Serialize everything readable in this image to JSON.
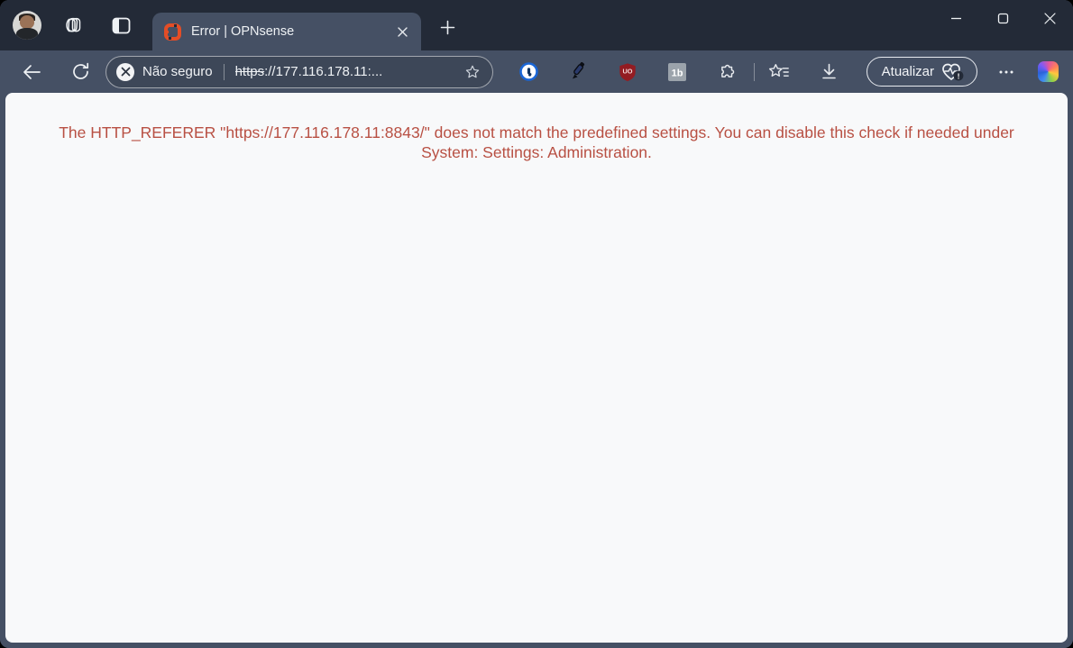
{
  "window": {
    "tab_title": "Error | OPNsense",
    "controls": {
      "minimize": "minimize",
      "maximize": "maximize",
      "close": "close"
    }
  },
  "toolbar": {
    "security_label": "Não seguro",
    "url_scheme": "https",
    "url_rest": "://177.116.178.11:...",
    "update_button_label": "Atualizar",
    "update_badge": "!"
  },
  "icons": {
    "ublock_glyph": "UO",
    "oneb_glyph": "1b"
  },
  "page": {
    "error_message": "The HTTP_REFERER \"https://177.116.178.11:8843/\" does not match the predefined settings. You can disable this check if needed under System: Settings: Administration."
  },
  "colors": {
    "titlebar": "#232a37",
    "chrome": "#455064",
    "page_background": "#f8f9fa",
    "error_text": "#b85043",
    "opnsense_orange": "#e44d26",
    "onepassword_blue": "#1a66d6",
    "ublock_red": "#931c22"
  }
}
